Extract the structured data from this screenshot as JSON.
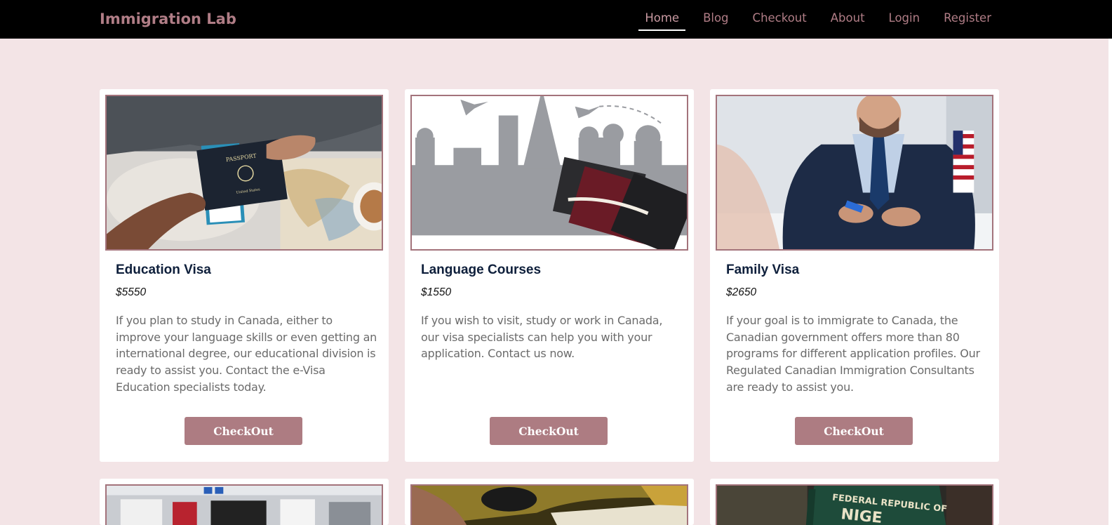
{
  "navbar": {
    "brand": "Immigration Lab",
    "links": [
      {
        "label": "Home",
        "active": true
      },
      {
        "label": "Blog",
        "active": false
      },
      {
        "label": "Checkout",
        "active": false
      },
      {
        "label": "About",
        "active": false
      },
      {
        "label": "Login",
        "active": false
      },
      {
        "label": "Register",
        "active": false
      }
    ]
  },
  "cards": [
    {
      "title": "Education Visa",
      "price": "$5550",
      "description": "If you plan to study in Canada, either to improve your language skills or even getting an international degree, our educational division is ready to assist you. Contact the e-Visa Education specialists today.",
      "button": "CheckOut",
      "image": "passport-handover-photo"
    },
    {
      "title": "Language Courses",
      "price": "$1550",
      "description": "If you wish to visit, study or work in Canada, our visa specialists can help you with your application. Contact us now.",
      "button": "CheckOut",
      "image": "world-landmarks-passports-illustration"
    },
    {
      "title": "Family Visa",
      "price": "$2650",
      "description": "If your goal is to immigrate to Canada, the Canadian government offers more than 80 programs for different application profiles. Our Regulated Canadian Immigration Consultants are ready to assist you.",
      "button": "CheckOut",
      "image": "consultant-at-desk-photo"
    }
  ],
  "bottom_cards": [
    {
      "image": "airport-check-in-photo"
    },
    {
      "image": "hand-holding-document-photo"
    },
    {
      "image": "nigerian-passport-photo",
      "image_text_line1": "FEDERAL REPUBLIC OF",
      "image_text_line2": "NIGE"
    }
  ],
  "colors": {
    "accent": "#ad7c82",
    "nav_text": "#b07d86",
    "background": "#f3e4e6",
    "title": "#0e1f3b"
  }
}
